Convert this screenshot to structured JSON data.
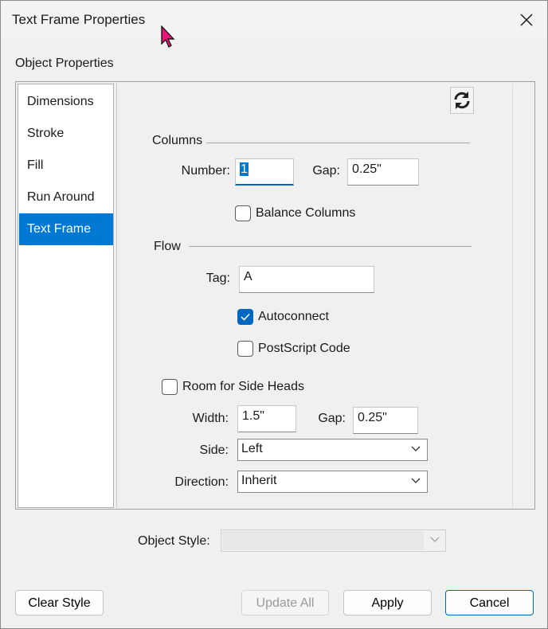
{
  "window": {
    "title": "Text Frame Properties"
  },
  "section_label": "Object Properties",
  "nav": {
    "items": [
      {
        "label": "Dimensions"
      },
      {
        "label": "Stroke"
      },
      {
        "label": "Fill"
      },
      {
        "label": "Run Around"
      },
      {
        "label": "Text Frame"
      }
    ],
    "selected": "Text Frame"
  },
  "columns": {
    "heading": "Columns",
    "number_label": "Number:",
    "number_value": "1",
    "gap_label": "Gap:",
    "gap_value": "0.25\"",
    "balance_label": "Balance Columns",
    "balance_checked": false
  },
  "flow": {
    "heading": "Flow",
    "tag_label": "Tag:",
    "tag_value": "A",
    "autoconnect_label": "Autoconnect",
    "autoconnect_checked": true,
    "postscript_label": "PostScript Code",
    "postscript_checked": false
  },
  "side_heads": {
    "label": "Room for Side Heads",
    "checked": false,
    "width_label": "Width:",
    "width_value": "1.5\"",
    "gap_label": "Gap:",
    "gap_value": "0.25\"",
    "side_label": "Side:",
    "side_value": "Left",
    "direction_label": "Direction:",
    "direction_value": "Inherit"
  },
  "object_style": {
    "label": "Object Style:",
    "value": ""
  },
  "buttons": {
    "clear_style": "Clear Style",
    "update_all": "Update All",
    "apply": "Apply",
    "cancel": "Cancel"
  },
  "colors": {
    "accent": "#0078d4",
    "focus": "#0067c0"
  },
  "icons": [
    "close-icon",
    "refresh-icon",
    "checkmark-icon",
    "chevron-down-icon",
    "mouse-cursor-icon"
  ]
}
